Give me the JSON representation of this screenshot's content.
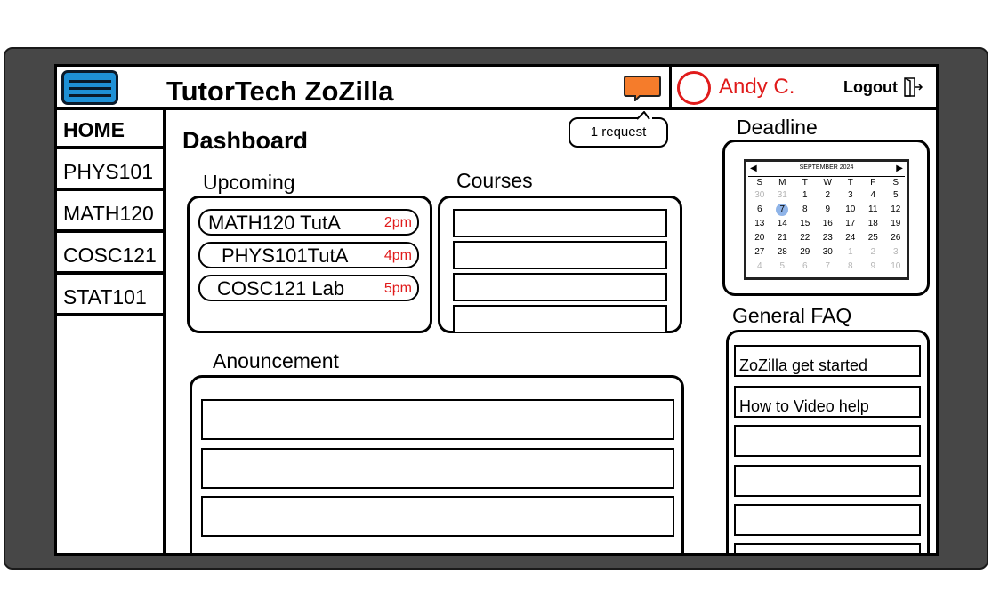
{
  "header": {
    "app_title": "TutorTech ZoZilla",
    "user_name": "Andy C.",
    "logout_label": "Logout"
  },
  "colors": {
    "accent_blue": "#1e90d6",
    "chat_orange": "#f57c2b",
    "alert_red": "#e01b1b",
    "frame": "#474747"
  },
  "sidebar": {
    "items": [
      {
        "label": "HOME",
        "active": true
      },
      {
        "label": "PHYS101",
        "active": false
      },
      {
        "label": "MATH120",
        "active": false
      },
      {
        "label": "COSC121",
        "active": false
      },
      {
        "label": "STAT101",
        "active": false
      }
    ]
  },
  "main": {
    "title": "Dashboard",
    "request_bubble": "1 request",
    "upcoming": {
      "label": "Upcoming",
      "items": [
        {
          "name": "MATH120 TutA",
          "time": "2pm"
        },
        {
          "name": "PHYS101TutA",
          "time": "4pm"
        },
        {
          "name": "COSC121 Lab",
          "time": "5pm"
        }
      ]
    },
    "courses": {
      "label": "Courses"
    },
    "announcement": {
      "label": "Anouncement"
    }
  },
  "right": {
    "deadline_label": "Deadline",
    "calendar": {
      "month": "SEPTEMBER 2024",
      "weekdays": [
        "S",
        "M",
        "T",
        "W",
        "T",
        "F",
        "S"
      ],
      "weeks": [
        [
          "30",
          "31",
          "1",
          "2",
          "3",
          "4",
          "5"
        ],
        [
          "6",
          "7",
          "8",
          "9",
          "10",
          "11",
          "12"
        ],
        [
          "13",
          "14",
          "15",
          "16",
          "17",
          "18",
          "19"
        ],
        [
          "20",
          "21",
          "22",
          "23",
          "24",
          "25",
          "26"
        ],
        [
          "27",
          "28",
          "29",
          "30",
          "1",
          "2",
          "3"
        ],
        [
          "4",
          "5",
          "6",
          "7",
          "8",
          "9",
          "10"
        ]
      ],
      "today": "7"
    },
    "faq": {
      "label": "General FAQ",
      "items": [
        "ZoZilla get started",
        "How to Video help",
        "",
        "",
        "",
        ""
      ]
    }
  }
}
